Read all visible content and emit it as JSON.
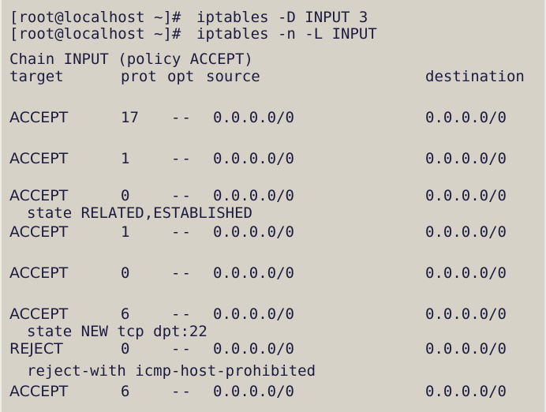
{
  "terminal": {
    "commands": [
      {
        "prompt": "[root@localhost ~]#",
        "command": "iptables -D INPUT 3"
      },
      {
        "prompt": "[root@localhost ~]#",
        "command": "iptables -n -L INPUT"
      }
    ],
    "chain_header": "Chain INPUT (policy ACCEPT)",
    "columns": {
      "target": "target",
      "prot": "prot",
      "opt": "opt",
      "source": "source",
      "destination": "destination"
    },
    "rules": [
      {
        "target": "ACCEPT",
        "prot": "17",
        "opt": "--",
        "source": "0.0.0.0/0",
        "destination": "0.0.0.0/0",
        "extra": ""
      },
      {
        "target": "ACCEPT",
        "prot": "1",
        "opt": "--",
        "source": "0.0.0.0/0",
        "destination": "0.0.0.0/0",
        "extra": ""
      },
      {
        "target": "ACCEPT",
        "prot": "0",
        "opt": "--",
        "source": "0.0.0.0/0",
        "destination": "0.0.0.0/0",
        "extra": "state RELATED,ESTABLISHED"
      },
      {
        "target": "ACCEPT",
        "prot": "1",
        "opt": "--",
        "source": "0.0.0.0/0",
        "destination": "0.0.0.0/0",
        "extra": ""
      },
      {
        "target": "ACCEPT",
        "prot": "0",
        "opt": "--",
        "source": "0.0.0.0/0",
        "destination": "0.0.0.0/0",
        "extra": ""
      },
      {
        "target": "ACCEPT",
        "prot": "6",
        "opt": "--",
        "source": "0.0.0.0/0",
        "destination": "0.0.0.0/0",
        "extra": "state NEW tcp dpt:22"
      },
      {
        "target": "REJECT",
        "prot": "0",
        "opt": "--",
        "source": "0.0.0.0/0",
        "destination": "0.0.0.0/0",
        "extra": "reject-with icmp-host-prohibited"
      },
      {
        "target": "ACCEPT",
        "prot": "6",
        "opt": "--",
        "source": "0.0.0.0/0",
        "destination": "0.0.0.0/0",
        "extra": ""
      }
    ]
  },
  "colors": {
    "background": "#d6d2c8",
    "text": "#1c1b3f"
  }
}
